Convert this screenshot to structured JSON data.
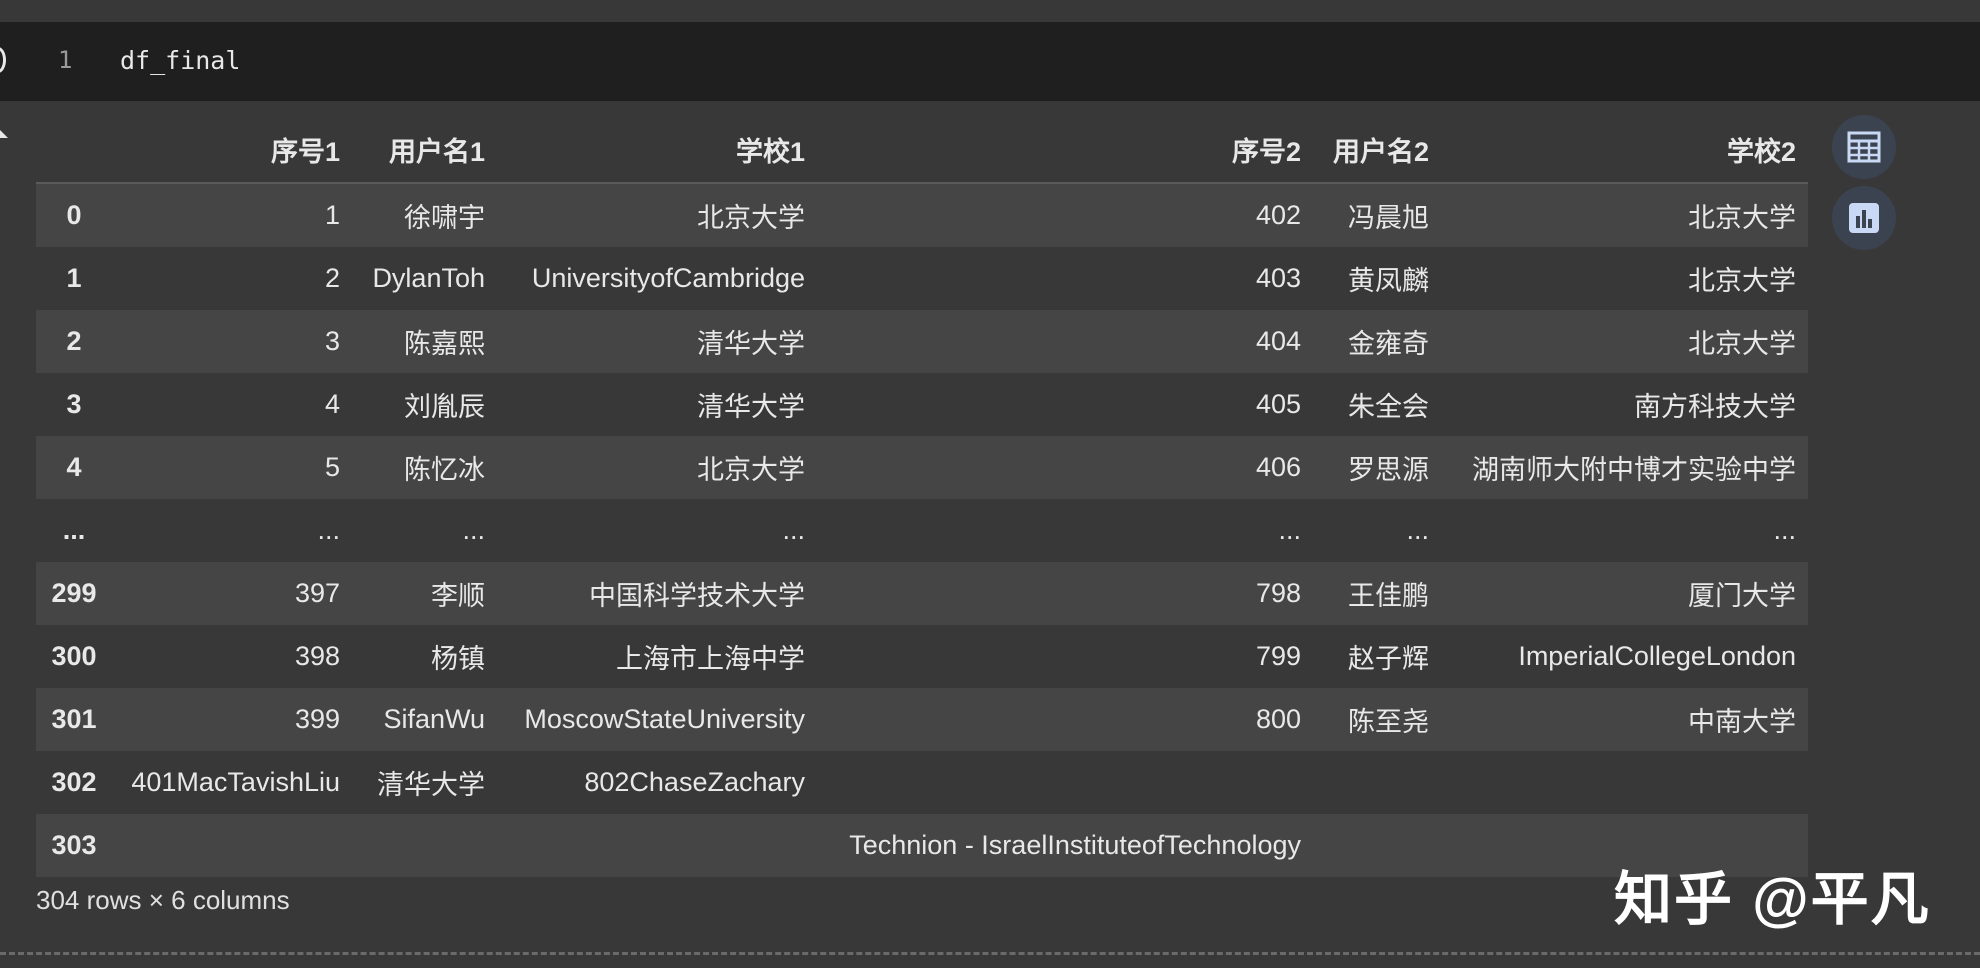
{
  "cell": {
    "line_number": "1",
    "code": "df_final"
  },
  "table": {
    "columns": [
      "序号1",
      "用户名1",
      "学校1",
      "序号2",
      "用户名2",
      "学校2"
    ],
    "rows": [
      {
        "index": "0",
        "c1": "1",
        "c2": "徐啸宇",
        "c3": "北京大学",
        "c4": "402",
        "c5": "冯晨旭",
        "c6": "北京大学"
      },
      {
        "index": "1",
        "c1": "2",
        "c2": "DylanToh",
        "c3": "UniversityofCambridge",
        "c4": "403",
        "c5": "黄凤麟",
        "c6": "北京大学"
      },
      {
        "index": "2",
        "c1": "3",
        "c2": "陈嘉熙",
        "c3": "清华大学",
        "c4": "404",
        "c5": "金雍奇",
        "c6": "北京大学"
      },
      {
        "index": "3",
        "c1": "4",
        "c2": "刘胤辰",
        "c3": "清华大学",
        "c4": "405",
        "c5": "朱全会",
        "c6": "南方科技大学"
      },
      {
        "index": "4",
        "c1": "5",
        "c2": "陈忆冰",
        "c3": "北京大学",
        "c4": "406",
        "c5": "罗思源",
        "c6": "湖南师大附中博才实验中学"
      },
      {
        "index": "...",
        "c1": "...",
        "c2": "...",
        "c3": "...",
        "c4": "...",
        "c5": "...",
        "c6": "..."
      },
      {
        "index": "299",
        "c1": "397",
        "c2": "李顺",
        "c3": "中国科学技术大学",
        "c4": "798",
        "c5": "王佳鹏",
        "c6": "厦门大学"
      },
      {
        "index": "300",
        "c1": "398",
        "c2": "杨镇",
        "c3": "上海市上海中学",
        "c4": "799",
        "c5": "赵子辉",
        "c6": "ImperialCollegeLondon"
      },
      {
        "index": "301",
        "c1": "399",
        "c2": "SifanWu",
        "c3": "MoscowStateUniversity",
        "c4": "800",
        "c5": "陈至尧",
        "c6": "中南大学"
      },
      {
        "index": "302",
        "c1": "401MacTavishLiu",
        "c2": "清华大学",
        "c3": "802ChaseZachary",
        "c4": "",
        "c5": "",
        "c6": ""
      }
    ],
    "last_row": {
      "index": "303",
      "text": "Technion - IsraelInstituteofTechnology"
    },
    "row_count": "304 rows × 6 columns"
  },
  "watermark": "知乎 @平凡",
  "icons": {
    "table_button": "table-icon",
    "chart_button": "bar-chart-icon"
  }
}
